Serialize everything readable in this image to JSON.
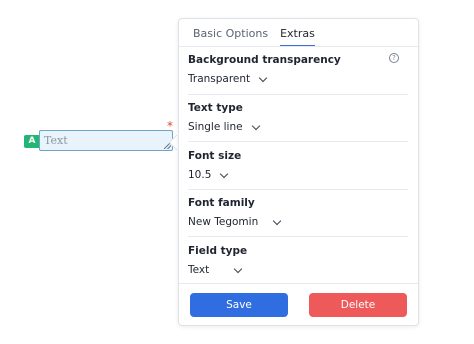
{
  "field": {
    "badge": "A",
    "placeholder": "Text",
    "required_mark": "*"
  },
  "panel": {
    "tabs": [
      {
        "label": "Basic Options",
        "active": false
      },
      {
        "label": "Extras",
        "active": true
      }
    ],
    "background_transparency": {
      "label": "Background transparency",
      "value": "Transparent",
      "help_icon": "help-circle-icon"
    },
    "text_type": {
      "label": "Text type",
      "value": "Single line"
    },
    "font_size": {
      "label": "Font size",
      "value": "10.5"
    },
    "font_family": {
      "label": "Font family",
      "value": "New Tegomin"
    },
    "field_type": {
      "label": "Field type",
      "value": "Text"
    },
    "save_label": "Save",
    "delete_label": "Delete"
  },
  "colors": {
    "badge": "#22b573",
    "save": "#2f6de0",
    "delete": "#ee5a5a",
    "required": "#e2453c",
    "active_tab": "#3a6fd8"
  }
}
